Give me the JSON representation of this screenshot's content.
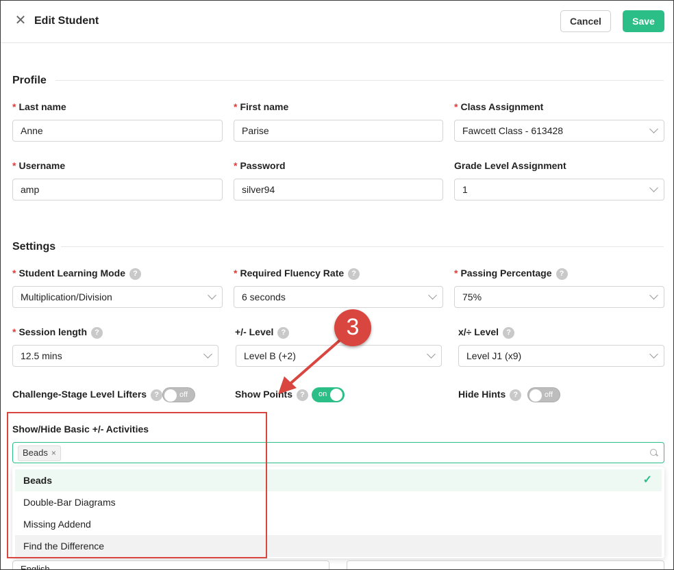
{
  "header": {
    "title": "Edit Student",
    "cancel_label": "Cancel",
    "save_label": "Save"
  },
  "profile": {
    "section_title": "Profile",
    "last_name": {
      "label": "Last name",
      "value": "Anne"
    },
    "first_name": {
      "label": "First name",
      "value": "Parise"
    },
    "class_assignment": {
      "label": "Class Assignment",
      "value": "Fawcett Class - 613428"
    },
    "username": {
      "label": "Username",
      "value": "amp"
    },
    "password": {
      "label": "Password",
      "value": "silver94"
    },
    "grade_level": {
      "label": "Grade Level Assignment",
      "value": "1"
    }
  },
  "settings": {
    "section_title": "Settings",
    "learning_mode": {
      "label": "Student Learning Mode",
      "value": "Multiplication/Division"
    },
    "fluency_rate": {
      "label": "Required Fluency Rate",
      "value": "6 seconds"
    },
    "passing_pct": {
      "label": "Passing Percentage",
      "value": "75%"
    },
    "session_length": {
      "label": "Session length",
      "value": "12.5 mins"
    },
    "plus_minus_level": {
      "label": "+/- Level",
      "value": "Level B (+2)"
    },
    "times_div_level": {
      "label": "x/÷ Level",
      "value": "Level J1 (x9)"
    },
    "level_lifters": {
      "label": "Challenge-Stage Level Lifters",
      "state": "off"
    },
    "show_points": {
      "label": "Show Points",
      "state": "on"
    },
    "hide_hints": {
      "label": "Hide Hints",
      "state": "off"
    },
    "help_glyph": "?"
  },
  "activities": {
    "label": "Show/Hide Basic +/- Activities",
    "selected_tags": [
      "Beads"
    ],
    "tag_remove_glyph": "×",
    "options": [
      {
        "label": "Beads",
        "selected": true
      },
      {
        "label": "Double-Bar Diagrams",
        "selected": false
      },
      {
        "label": "Missing Addend",
        "selected": false
      },
      {
        "label": "Find the Difference",
        "selected": false
      }
    ],
    "check_glyph": "✓"
  },
  "below": {
    "language_value": "English"
  },
  "annotation": {
    "callout_number": "3",
    "callout_color": "#d9453f"
  },
  "colors": {
    "accent": "#2bbf87",
    "required": "#e03c3c"
  }
}
